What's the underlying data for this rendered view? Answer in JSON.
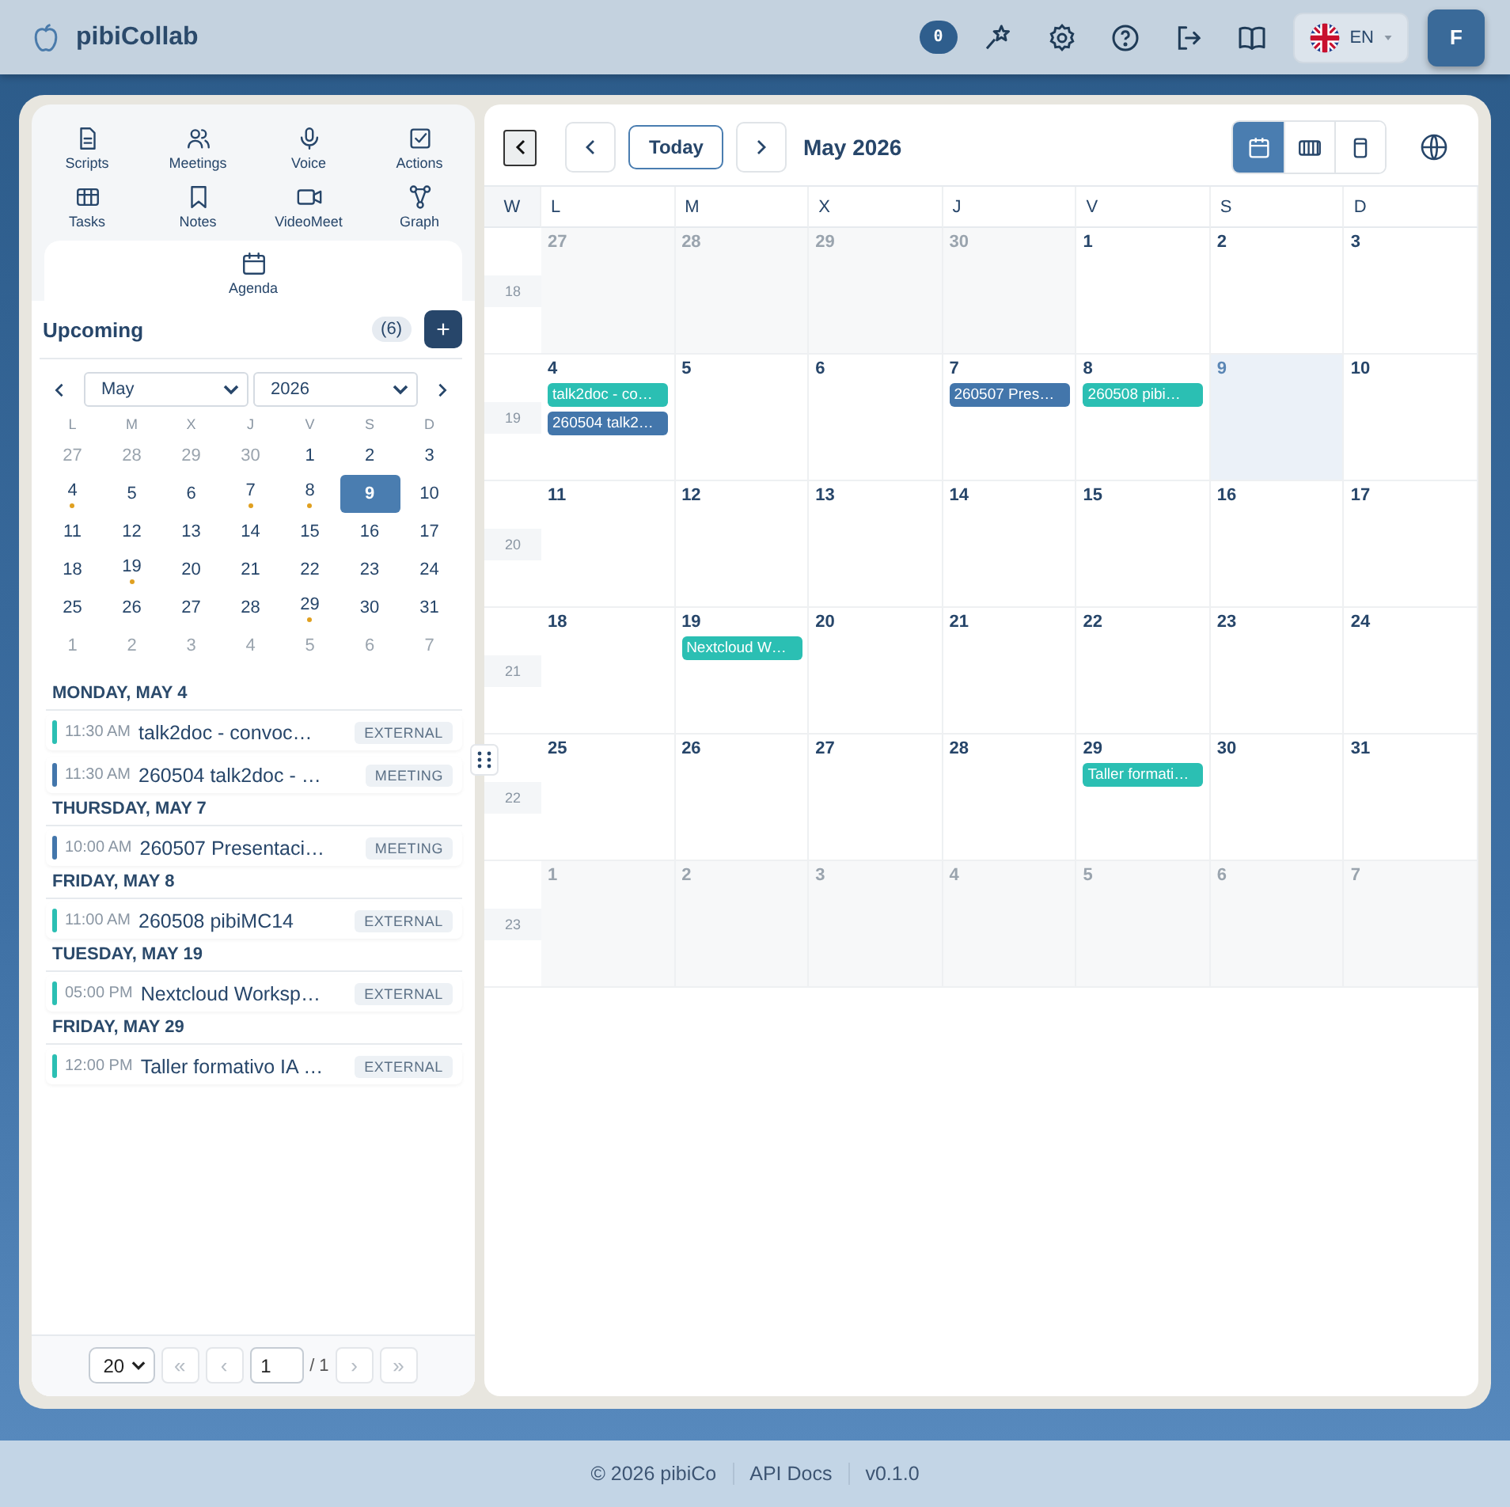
{
  "header": {
    "app_name": "pibiCollab",
    "notification_count": "0",
    "language": "EN",
    "avatar_initial": "F"
  },
  "nav": [
    {
      "label": "Scripts",
      "selected": false
    },
    {
      "label": "Meetings",
      "selected": false
    },
    {
      "label": "Voice",
      "selected": false
    },
    {
      "label": "Actions",
      "selected": false
    },
    {
      "label": "Tasks",
      "selected": false
    },
    {
      "label": "Notes",
      "selected": false
    },
    {
      "label": "VideoMeet",
      "selected": false
    },
    {
      "label": "Graph",
      "selected": false
    },
    {
      "label": "Agenda",
      "selected": true
    }
  ],
  "upcoming": {
    "title": "Upcoming",
    "count": "(6)",
    "add": "+"
  },
  "mini_calendar": {
    "month": "May",
    "year": "2026",
    "weekdays": [
      "L",
      "M",
      "X",
      "J",
      "V",
      "S",
      "D"
    ],
    "weeks": [
      {
        "days": [
          {
            "day": "27",
            "outside": true,
            "selected": false,
            "has_event": false
          },
          {
            "day": "28",
            "outside": true,
            "selected": false,
            "has_event": false
          },
          {
            "day": "29",
            "outside": true,
            "selected": false,
            "has_event": false
          },
          {
            "day": "30",
            "outside": true,
            "selected": false,
            "has_event": false
          },
          {
            "day": "1",
            "outside": false,
            "selected": false,
            "has_event": false
          },
          {
            "day": "2",
            "outside": false,
            "selected": false,
            "has_event": false
          },
          {
            "day": "3",
            "outside": false,
            "selected": false,
            "has_event": false
          }
        ]
      },
      {
        "days": [
          {
            "day": "4",
            "outside": false,
            "selected": false,
            "has_event": true
          },
          {
            "day": "5",
            "outside": false,
            "selected": false,
            "has_event": false
          },
          {
            "day": "6",
            "outside": false,
            "selected": false,
            "has_event": false
          },
          {
            "day": "7",
            "outside": false,
            "selected": false,
            "has_event": true
          },
          {
            "day": "8",
            "outside": false,
            "selected": false,
            "has_event": true
          },
          {
            "day": "9",
            "outside": false,
            "selected": true,
            "has_event": false
          },
          {
            "day": "10",
            "outside": false,
            "selected": false,
            "has_event": false
          }
        ]
      },
      {
        "days": [
          {
            "day": "11",
            "outside": false,
            "selected": false,
            "has_event": false
          },
          {
            "day": "12",
            "outside": false,
            "selected": false,
            "has_event": false
          },
          {
            "day": "13",
            "outside": false,
            "selected": false,
            "has_event": false
          },
          {
            "day": "14",
            "outside": false,
            "selected": false,
            "has_event": false
          },
          {
            "day": "15",
            "outside": false,
            "selected": false,
            "has_event": false
          },
          {
            "day": "16",
            "outside": false,
            "selected": false,
            "has_event": false
          },
          {
            "day": "17",
            "outside": false,
            "selected": false,
            "has_event": false
          }
        ]
      },
      {
        "days": [
          {
            "day": "18",
            "outside": false,
            "selected": false,
            "has_event": false
          },
          {
            "day": "19",
            "outside": false,
            "selected": false,
            "has_event": true
          },
          {
            "day": "20",
            "outside": false,
            "selected": false,
            "has_event": false
          },
          {
            "day": "21",
            "outside": false,
            "selected": false,
            "has_event": false
          },
          {
            "day": "22",
            "outside": false,
            "selected": false,
            "has_event": false
          },
          {
            "day": "23",
            "outside": false,
            "selected": false,
            "has_event": false
          },
          {
            "day": "24",
            "outside": false,
            "selected": false,
            "has_event": false
          }
        ]
      },
      {
        "days": [
          {
            "day": "25",
            "outside": false,
            "selected": false,
            "has_event": false
          },
          {
            "day": "26",
            "outside": false,
            "selected": false,
            "has_event": false
          },
          {
            "day": "27",
            "outside": false,
            "selected": false,
            "has_event": false
          },
          {
            "day": "28",
            "outside": false,
            "selected": false,
            "has_event": false
          },
          {
            "day": "29",
            "outside": false,
            "selected": false,
            "has_event": true
          },
          {
            "day": "30",
            "outside": false,
            "selected": false,
            "has_event": false
          },
          {
            "day": "31",
            "outside": false,
            "selected": false,
            "has_event": false
          }
        ]
      },
      {
        "days": [
          {
            "day": "1",
            "outside": true,
            "selected": false,
            "has_event": false
          },
          {
            "day": "2",
            "outside": true,
            "selected": false,
            "has_event": false
          },
          {
            "day": "3",
            "outside": true,
            "selected": false,
            "has_event": false
          },
          {
            "day": "4",
            "outside": true,
            "selected": false,
            "has_event": false
          },
          {
            "day": "5",
            "outside": true,
            "selected": false,
            "has_event": false
          },
          {
            "day": "6",
            "outside": true,
            "selected": false,
            "has_event": false
          },
          {
            "day": "7",
            "outside": true,
            "selected": false,
            "has_event": false
          }
        ]
      }
    ]
  },
  "agenda": [
    {
      "heading": "MONDAY, MAY 4",
      "events": [
        {
          "time": "11:30 AM",
          "title": "talk2doc - convoc…",
          "tag": "EXTERNAL",
          "color": "#2bbfb3"
        },
        {
          "time": "11:30 AM",
          "title": "260504 talk2doc - …",
          "tag": "MEETING",
          "color": "#4376ab"
        }
      ]
    },
    {
      "heading": "THURSDAY, MAY 7",
      "events": [
        {
          "time": "10:00 AM",
          "title": "260507 Presentaci…",
          "tag": "MEETING",
          "color": "#4376ab"
        }
      ]
    },
    {
      "heading": "FRIDAY, MAY 8",
      "events": [
        {
          "time": "11:00 AM",
          "title": "260508 pibiMC14",
          "tag": "EXTERNAL",
          "color": "#2bbfb3"
        }
      ]
    },
    {
      "heading": "TUESDAY, MAY 19",
      "events": [
        {
          "time": "05:00 PM",
          "title": "Nextcloud Worksp…",
          "tag": "EXTERNAL",
          "color": "#2bbfb3"
        }
      ]
    },
    {
      "heading": "FRIDAY, MAY 29",
      "events": [
        {
          "time": "12:00 PM",
          "title": "Taller formativo IA …",
          "tag": "EXTERNAL",
          "color": "#2bbfb3"
        }
      ]
    }
  ],
  "pagination": {
    "page_size": "20",
    "first": "«",
    "prev": "‹",
    "page": "1",
    "total": "/ 1",
    "next": "›",
    "last": "»"
  },
  "calendar": {
    "today_button": "Today",
    "title": "May 2026",
    "views": [
      {
        "selected": true
      },
      {
        "selected": false
      },
      {
        "selected": false
      }
    ],
    "week_label": "W",
    "weekdays": [
      "L",
      "M",
      "X",
      "J",
      "V",
      "S",
      "D"
    ],
    "weeks": [
      {
        "number": "18",
        "days": [
          {
            "day": "27",
            "outside": true,
            "today": false
          },
          {
            "day": "28",
            "outside": true,
            "today": false
          },
          {
            "day": "29",
            "outside": true,
            "today": false
          },
          {
            "day": "30",
            "outside": true,
            "today": false
          },
          {
            "day": "1",
            "outside": false,
            "today": false
          },
          {
            "day": "2",
            "outside": false,
            "today": false
          },
          {
            "day": "3",
            "outside": false,
            "today": false
          }
        ]
      },
      {
        "number": "19",
        "days": [
          {
            "day": "4",
            "outside": false,
            "today": false,
            "events": [
              {
                "title": "talk2doc - co…",
                "color": "#2bbfb3"
              },
              {
                "title": "260504 talk2…",
                "color": "#4376ab"
              }
            ]
          },
          {
            "day": "5",
            "outside": false,
            "today": false
          },
          {
            "day": "6",
            "outside": false,
            "today": false
          },
          {
            "day": "7",
            "outside": false,
            "today": false,
            "events": [
              {
                "title": "260507 Pres…",
                "color": "#4376ab"
              }
            ]
          },
          {
            "day": "8",
            "outside": false,
            "today": false,
            "events": [
              {
                "title": "260508 pibi…",
                "color": "#2bbfb3"
              }
            ]
          },
          {
            "day": "9",
            "outside": false,
            "today": true
          },
          {
            "day": "10",
            "outside": false,
            "today": false
          }
        ]
      },
      {
        "number": "20",
        "days": [
          {
            "day": "11",
            "outside": false,
            "today": false
          },
          {
            "day": "12",
            "outside": false,
            "today": false
          },
          {
            "day": "13",
            "outside": false,
            "today": false
          },
          {
            "day": "14",
            "outside": false,
            "today": false
          },
          {
            "day": "15",
            "outside": false,
            "today": false
          },
          {
            "day": "16",
            "outside": false,
            "today": false
          },
          {
            "day": "17",
            "outside": false,
            "today": false
          }
        ]
      },
      {
        "number": "21",
        "days": [
          {
            "day": "18",
            "outside": false,
            "today": false
          },
          {
            "day": "19",
            "outside": false,
            "today": false,
            "events": [
              {
                "title": "Nextcloud W…",
                "color": "#2bbfb3"
              }
            ]
          },
          {
            "day": "20",
            "outside": false,
            "today": false
          },
          {
            "day": "21",
            "outside": false,
            "today": false
          },
          {
            "day": "22",
            "outside": false,
            "today": false
          },
          {
            "day": "23",
            "outside": false,
            "today": false
          },
          {
            "day": "24",
            "outside": false,
            "today": false
          }
        ]
      },
      {
        "number": "22",
        "days": [
          {
            "day": "25",
            "outside": false,
            "today": false
          },
          {
            "day": "26",
            "outside": false,
            "today": false
          },
          {
            "day": "27",
            "outside": false,
            "today": false
          },
          {
            "day": "28",
            "outside": false,
            "today": false
          },
          {
            "day": "29",
            "outside": false,
            "today": false,
            "events": [
              {
                "title": "Taller formati…",
                "color": "#2bbfb3"
              }
            ]
          },
          {
            "day": "30",
            "outside": false,
            "today": false
          },
          {
            "day": "31",
            "outside": false,
            "today": false
          }
        ]
      },
      {
        "number": "23",
        "days": [
          {
            "day": "1",
            "outside": true,
            "today": false
          },
          {
            "day": "2",
            "outside": true,
            "today": false
          },
          {
            "day": "3",
            "outside": true,
            "today": false
          },
          {
            "day": "4",
            "outside": true,
            "today": false
          },
          {
            "day": "5",
            "outside": true,
            "today": false
          },
          {
            "day": "6",
            "outside": true,
            "today": false
          },
          {
            "day": "7",
            "outside": true,
            "today": false
          }
        ]
      }
    ]
  },
  "footer": [
    "© 2026 pibiCo",
    "API Docs",
    "v0.1.0"
  ]
}
